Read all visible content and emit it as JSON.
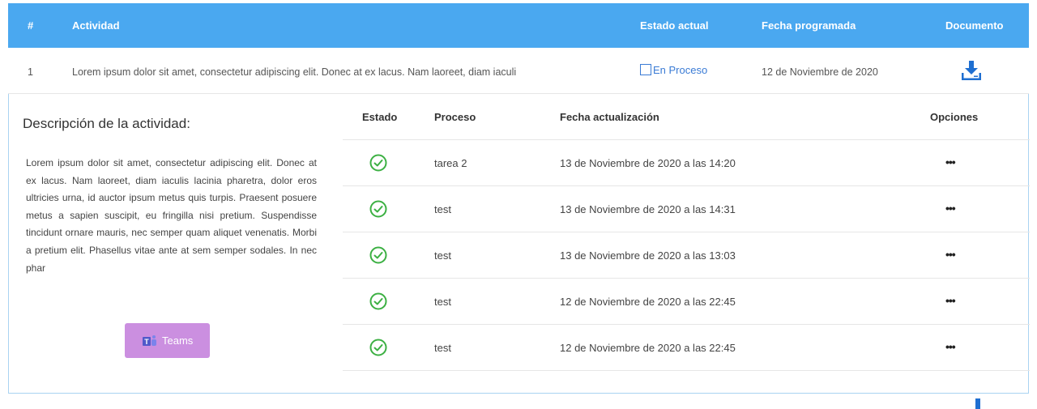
{
  "table": {
    "headers": {
      "num": "#",
      "actividad": "Actividad",
      "estado_actual": "Estado actual",
      "fecha_programada": "Fecha programada",
      "documento": "Documento"
    },
    "row": {
      "num": "1",
      "actividad": "Lorem ipsum dolor sit amet, consectetur adipiscing elit. Donec at ex lacus. Nam laoreet, diam iaculi",
      "estado": "En Proceso",
      "fecha": "12 de Noviembre de 2020",
      "documento_icon": "download-icon"
    }
  },
  "detail": {
    "title": "Descripción de la actividad:",
    "description": "Lorem ipsum dolor sit amet, consectetur adipiscing elit. Donec at ex lacus. Nam laoreet, diam iaculis lacinia pharetra, dolor eros ultricies urna, id auctor ipsum metus quis turpis. Praesent posuere metus a sapien suscipit, eu fringilla nisi pretium. Suspendisse tincidunt ornare mauris, nec semper quam aliquet venenatis. Morbi a pretium elit. Phasellus vitae ante at sem semper sodales. In nec phar",
    "teams_label": "Teams",
    "sub_headers": {
      "estado": "Estado",
      "proceso": "Proceso",
      "fecha": "Fecha actualización",
      "opciones": "Opciones"
    },
    "rows": [
      {
        "proceso": "tarea 2",
        "fecha": "13 de Noviembre de 2020 a las 14:20",
        "opciones": "•••"
      },
      {
        "proceso": "test",
        "fecha": "13 de Noviembre de 2020 a las 14:31",
        "opciones": "•••"
      },
      {
        "proceso": "test",
        "fecha": "13 de Noviembre de 2020 a las 13:03",
        "opciones": "•••"
      },
      {
        "proceso": "test",
        "fecha": "12 de Noviembre de 2020 a las 22:45",
        "opciones": "•••"
      },
      {
        "proceso": "test",
        "fecha": "12 de Noviembre de 2020 a las 22:45",
        "opciones": "•••"
      }
    ]
  },
  "colors": {
    "header_bg": "#4aa8f0",
    "link": "#3a7bd5",
    "check": "#3cb043",
    "teams_bg": "#cb8fe0",
    "panel_border": "#a9d3f2"
  }
}
